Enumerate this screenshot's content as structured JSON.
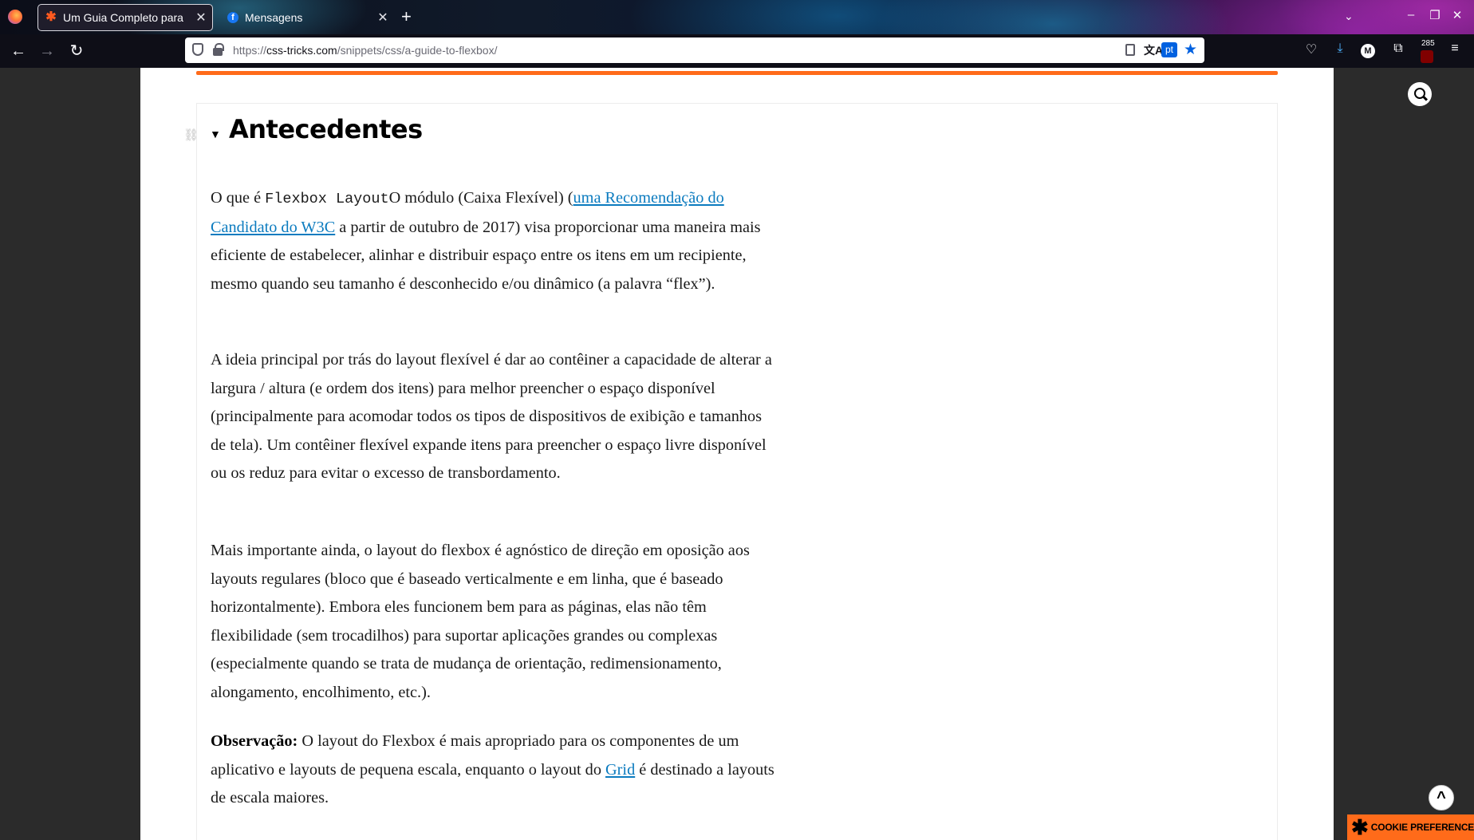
{
  "browser": {
    "tabs": [
      {
        "title": "Um Guia Completo para",
        "favicon": "css-tricks-star-icon",
        "active": true
      },
      {
        "title": "Mensagens",
        "favicon": "facebook-icon",
        "active": false
      }
    ],
    "new_tab_label": "+",
    "url": {
      "scheme": "https://",
      "host": "css-tricks.com",
      "path": "/snippets/css/a-guide-to-flexbox/"
    },
    "translate_lang": "pt",
    "toolbar_badge": "285"
  },
  "article": {
    "heading": "Antecedentes",
    "p1": {
      "t1": "O que é ",
      "code": "Flexbox Layout",
      "t2": "O módulo (Caixa Flexível) (",
      "link": "uma Recomendação do Candidato do W3C",
      "t3": " a partir de outubro de 2017) visa proporcionar uma maneira mais eficiente de estabelecer, alinhar e distribuir espaço entre os itens em um recipiente, mesmo quando seu tamanho é desconhecido e/ou dinâmico (a palavra “flex”)."
    },
    "p2": "A ideia principal por trás do layout flexível é dar ao contêiner a capacidade de alterar a largura / altura (e ordem dos itens) para melhor preencher o espaço disponível (principalmente para acomodar todos os tipos de dispositivos de exibição e tamanhos de tela). Um contêiner flexível expande itens para preencher o espaço livre disponível ou os reduz para evitar o excesso de transbordamento.",
    "p3": "Mais importante ainda, o layout do flexbox é agnóstico de direção em oposição aos layouts regulares (bloco que é baseado verticalmente e em linha, que é baseado horizontalmente). Embora eles funcionem bem para as páginas, elas não têm flexibilidade (sem trocadilhos) para suportar aplicações grandes ou complexas (especialmente quando se trata de mudança de orientação, redimensionamento, alongamento, encolhimento, etc.).",
    "p4": {
      "label": "Observação:",
      "t1": " O layout do Flexbox é mais apropriado para os componentes de um aplicativo e layouts de pequena escala, enquanto o layout do ",
      "link": "Grid",
      "t2": " é destinado a layouts de escala maiores."
    }
  },
  "cookie_label": "COOKIE PREFERENCES",
  "colors": {
    "accent": "#ff6b1a",
    "link": "#0b7bbf",
    "browser_blue": "#0061e0"
  }
}
